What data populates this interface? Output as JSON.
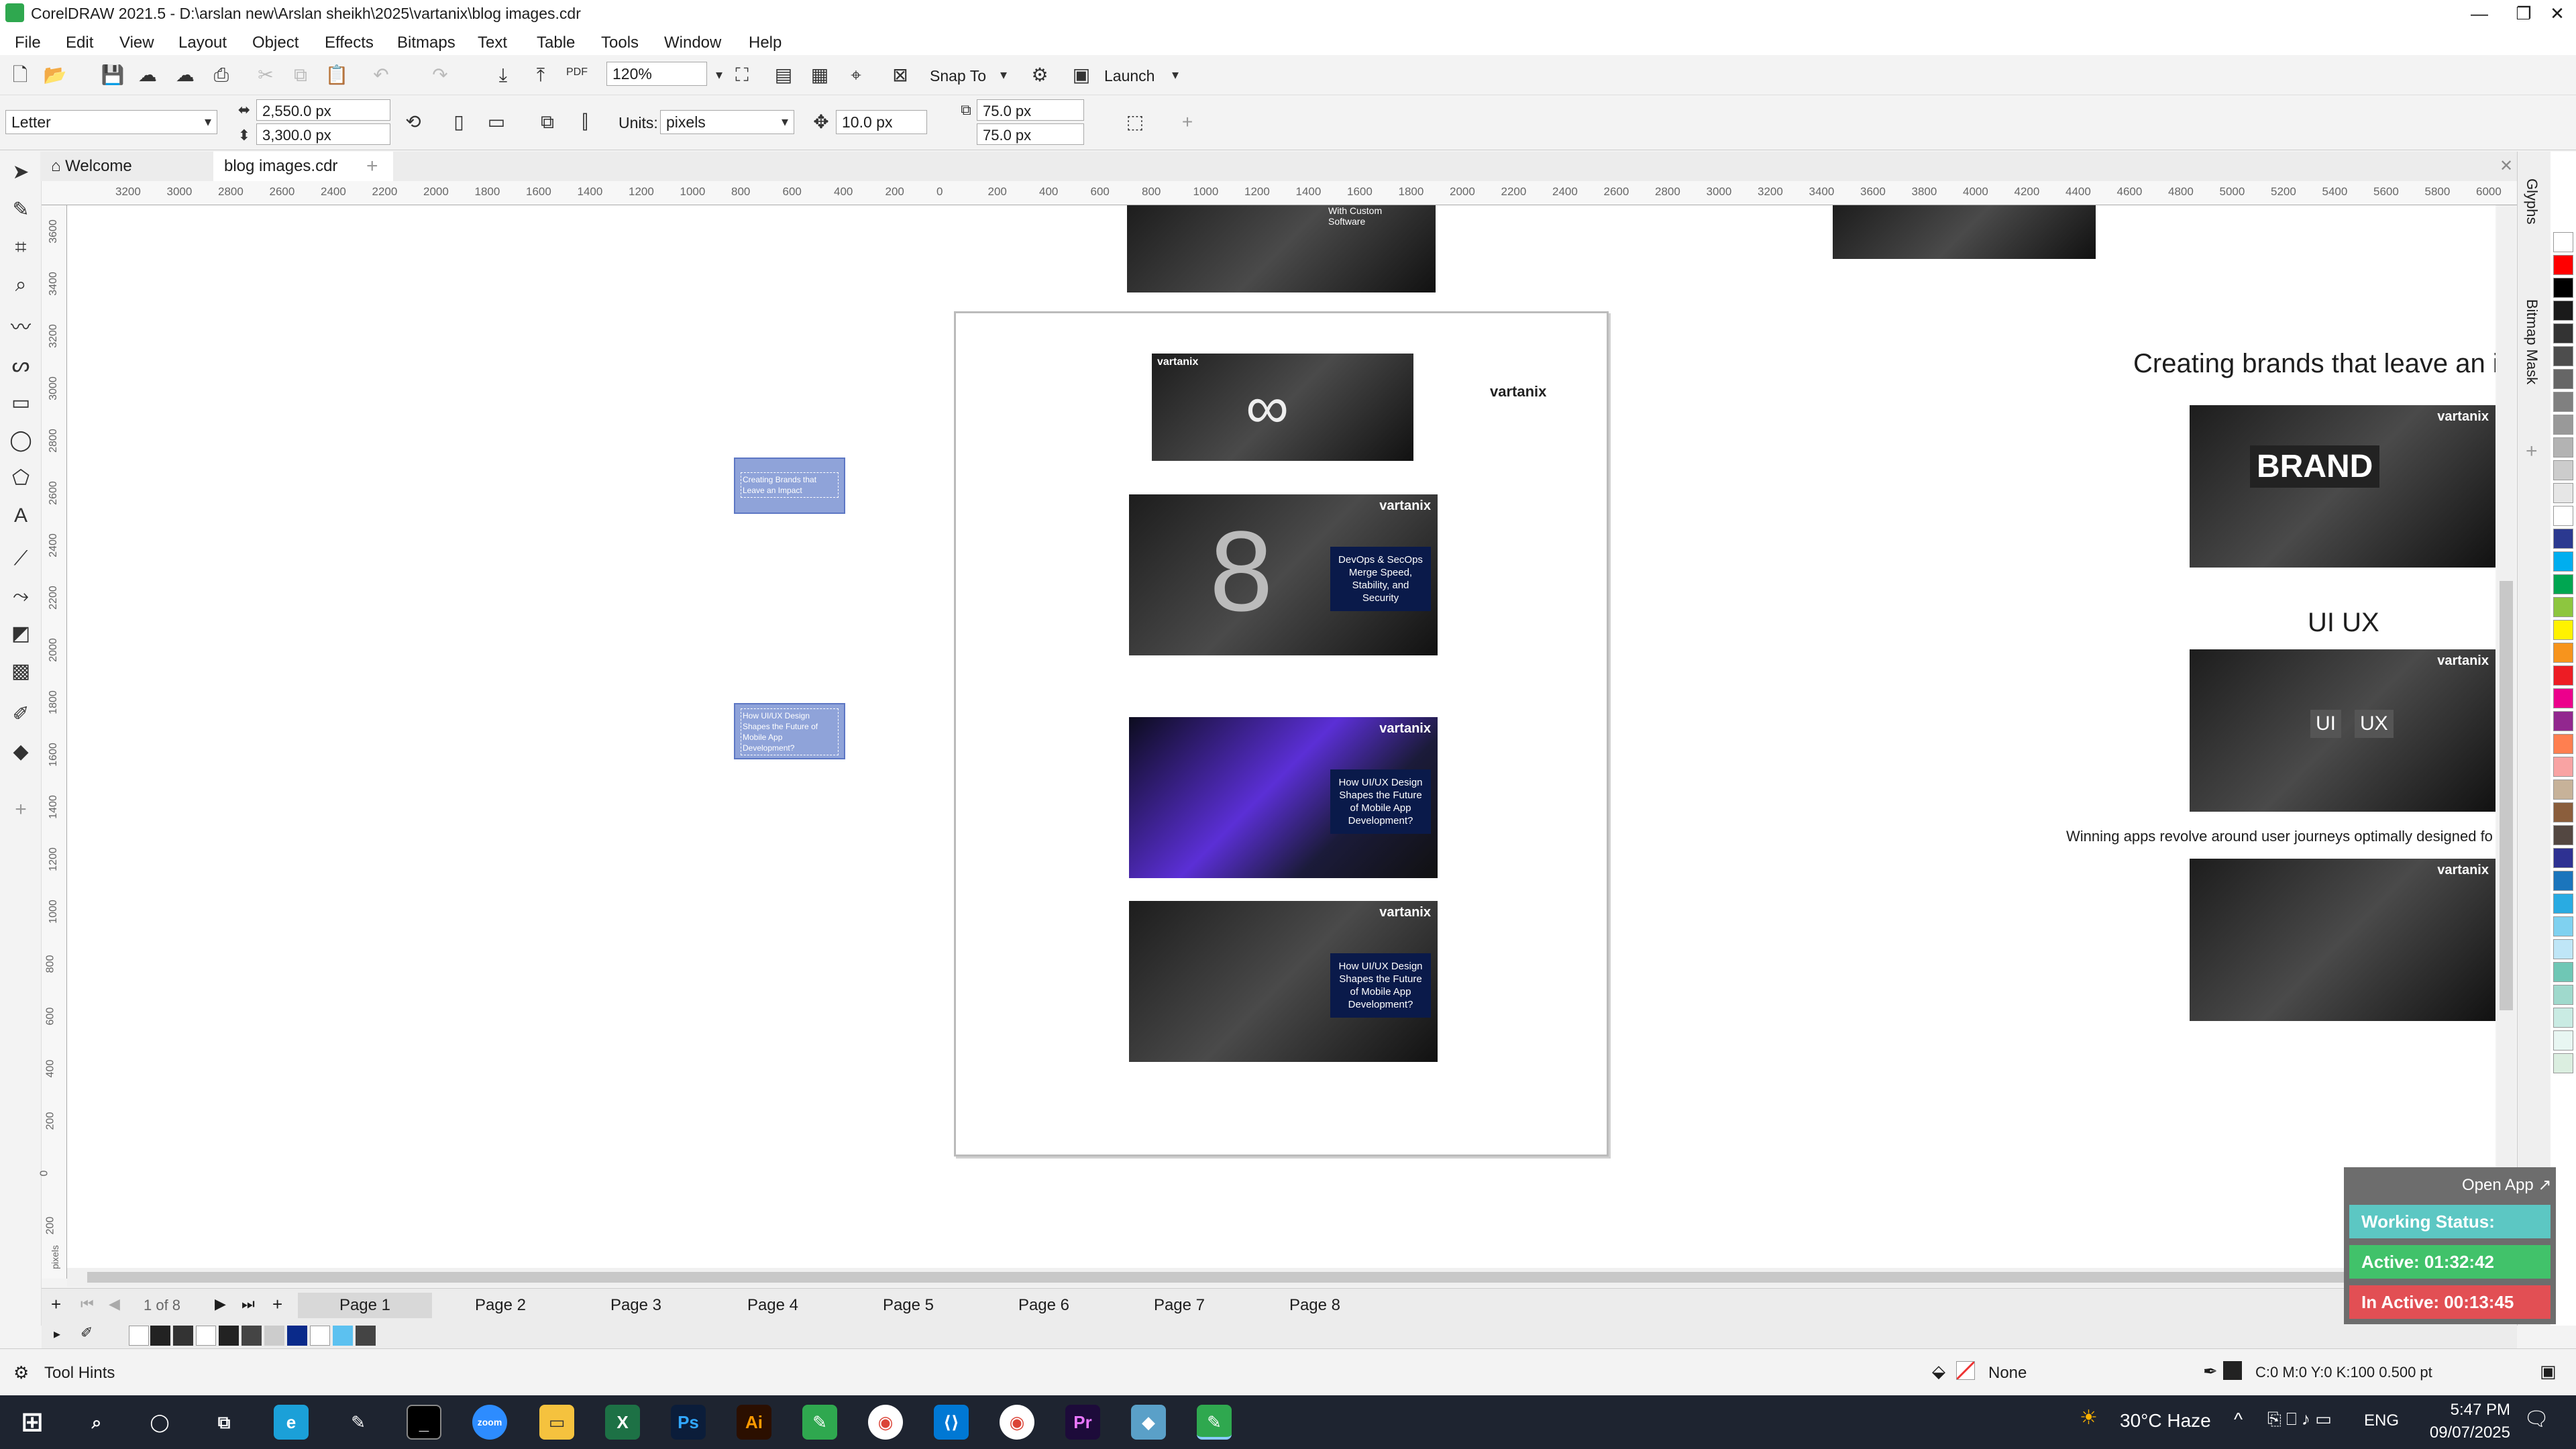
{
  "window": {
    "title": "CorelDRAW 2021.5 - D:\\arslan new\\Arslan sheikh\\2025\\vartanix\\blog images.cdr",
    "minimize": "—",
    "maximize": "❐",
    "close": "✕"
  },
  "menu": [
    "File",
    "Edit",
    "View",
    "Layout",
    "Object",
    "Effects",
    "Bitmaps",
    "Text",
    "Table",
    "Tools",
    "Window",
    "Help"
  ],
  "toolbar": {
    "zoom": "120%",
    "snap_to": "Snap To",
    "launch": "Launch",
    "pdf": "PDF"
  },
  "properties": {
    "page_size": "Letter",
    "width": "2,550.0 px",
    "height": "3,300.0 px",
    "units_label": "Units:",
    "units": "pixels",
    "nudge": "10.0 px",
    "dup_x": "75.0 px",
    "dup_y": "75.0 px"
  },
  "tabs": [
    "Welcome Screen",
    "blog images.cdr"
  ],
  "hruler_ticks": [
    "3200",
    "3000",
    "2800",
    "2600",
    "2400",
    "2200",
    "2000",
    "1800",
    "1600",
    "1400",
    "1200",
    "1000",
    "800",
    "600",
    "400",
    "200",
    "0",
    "200",
    "400",
    "600",
    "800",
    "1000",
    "1200",
    "1400",
    "1600",
    "1800",
    "2000",
    "2200",
    "2400",
    "2600",
    "2800",
    "3000",
    "3200",
    "3400",
    "3600",
    "3800",
    "4000",
    "4200",
    "4400",
    "4600",
    "4800",
    "5000",
    "5200",
    "5400",
    "5600",
    "5800",
    "6000"
  ],
  "vruler_ticks": [
    "3600",
    "3400",
    "3200",
    "3000",
    "2800",
    "2600",
    "2400",
    "2200",
    "2000",
    "1800",
    "1600",
    "1400",
    "1200",
    "1000",
    "800",
    "600",
    "400",
    "200",
    "0",
    "200"
  ],
  "vruler_unit": "pixels",
  "canvas": {
    "top_img_caption": "With Custom Software",
    "logo": "vartanix",
    "devops_caption": "DevOps & SecOps Merge Speed, Stability, and Security",
    "uiux_caption": "How UI/UX Design Shapes the Future of Mobile App Development?",
    "uiux_caption2": "How UI/UX Design Shapes the Future of Mobile App Development?",
    "sel1": "Creating Brands that Leave an Impact",
    "sel2": "How UI/UX Design Shapes the Future of Mobile App Development?",
    "heading_brands": "Creating brands that leave an in",
    "brand_word": "BRAND",
    "heading_uiux": "UI UX",
    "ui_label": "UI",
    "ux_label": "UX",
    "winning": "Winning apps revolve around user journeys optimally designed fo"
  },
  "docker": {
    "glyphs": "Glyphs",
    "bitmap_mask": "Bitmap Mask"
  },
  "pagenav": {
    "counter": "1 of 8",
    "pages": [
      "Page 1",
      "Page 2",
      "Page 3",
      "Page 4",
      "Page 5",
      "Page 6",
      "Page 7",
      "Page 8"
    ]
  },
  "status": {
    "tool_hints": "Tool Hints",
    "fill": "None",
    "outline": "C:0 M:0 Y:0 K:100  0.500 pt"
  },
  "tracker": {
    "open_app": "Open App ↗",
    "working": "Working Status: Active",
    "active": "Active: 01:32:42",
    "inactive": "In Active: 00:13:45"
  },
  "taskbar": {
    "weather": "30°C  Haze",
    "lang": "ENG",
    "time": "5:47 PM",
    "date": "09/07/2025",
    "apps": [
      "Ps",
      "Ai",
      "Pr"
    ]
  },
  "colors": {
    "accent_green": "#2fa84f",
    "tracker_teal": "#5cc7c3",
    "tracker_green": "#41c26a",
    "tracker_red": "#e24f54"
  }
}
